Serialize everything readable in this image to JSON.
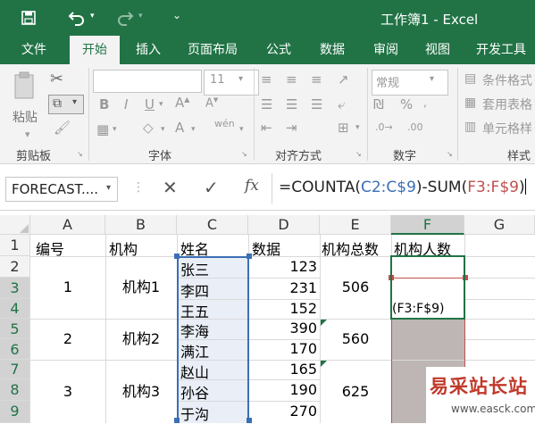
{
  "title": {
    "doc_title": "工作簿1 - Excel",
    "save_icon": "save-icon",
    "undo_icon": "undo-icon",
    "redo_icon": "redo-icon",
    "customize_icon": "customize-qat-icon"
  },
  "tabs": [
    "文件",
    "开始",
    "插入",
    "页面布局",
    "公式",
    "数据",
    "审阅",
    "视图",
    "开发工具"
  ],
  "ribbon": {
    "clipboard": {
      "paste_label": "粘贴",
      "group_label": "剪贴板"
    },
    "font": {
      "font_name": "",
      "font_size": "11",
      "group_label": "字体",
      "bold": "B",
      "italic": "I",
      "underline": "U",
      "wen": "wén"
    },
    "alignment": {
      "group_label": "对齐方式"
    },
    "number": {
      "format": "常规",
      "group_label": "数字"
    },
    "styles": {
      "conditional": "条件格式",
      "table": "套用表格",
      "cell": "单元格样",
      "group_label": "样式"
    }
  },
  "formula_bar": {
    "name_box": "FORECAST....",
    "fx": "fx",
    "formula_prefix": "=COUNTA(",
    "formula_ref1": "C2:C$9",
    "formula_mid": ")-SUM(",
    "formula_ref2": "F3:F$9",
    "formula_suffix": ")"
  },
  "columns": [
    "A",
    "B",
    "C",
    "D",
    "E",
    "F",
    "G"
  ],
  "rows": [
    "1",
    "2",
    "3",
    "4",
    "5",
    "6",
    "7",
    "8",
    "9"
  ],
  "headers": {
    "a": "编号",
    "b": "机构",
    "c": "姓名",
    "d": "数据",
    "e": "机构总数",
    "f": "机构人数"
  },
  "groups": [
    {
      "no": "1",
      "org": "机构1",
      "total": "506"
    },
    {
      "no": "2",
      "org": "机构2",
      "total": "560"
    },
    {
      "no": "3",
      "org": "机构3",
      "total": "625"
    }
  ],
  "names": [
    "张三",
    "李四",
    "王五",
    "李海",
    "满江",
    "赵山",
    "孙谷",
    "于沟"
  ],
  "values": [
    "123",
    "231",
    "152",
    "390",
    "170",
    "165",
    "190",
    "270"
  ],
  "edit_hint": "(F3:F$9)",
  "watermark": {
    "text": "易采站长站",
    "url": "www.easck.com"
  },
  "colors": {
    "excel_green": "#217346",
    "ref_blue": "#3b6fb5",
    "ref_red": "#c0504d",
    "fill_gray": "#bdb6b4"
  }
}
